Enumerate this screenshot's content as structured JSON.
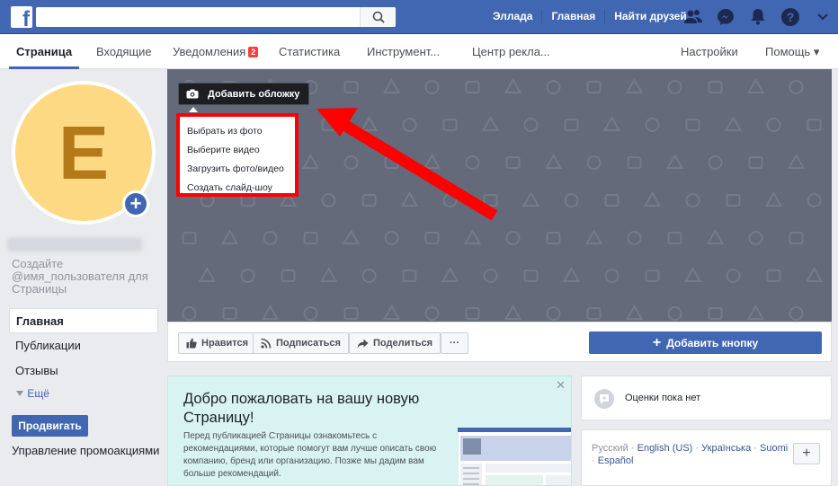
{
  "topbar": {
    "nav_links": [
      "Эллада",
      "Главная",
      "Найти друзей"
    ],
    "icons": [
      "friends-icon",
      "messenger-icon",
      "notifications-icon",
      "help-icon",
      "account-menu-icon"
    ]
  },
  "tabs": [
    {
      "label": "Страница"
    },
    {
      "label": "Входящие"
    },
    {
      "label": "Уведомления",
      "badge": "2"
    },
    {
      "label": "Статистика"
    },
    {
      "label": "Инструмент..."
    },
    {
      "label": "Центр рекла..."
    },
    {
      "label": "Настройки"
    },
    {
      "label": "Помощь ▾"
    }
  ],
  "profile": {
    "initial": "E",
    "create_username": "Создайте @имя_пользователя для Страницы"
  },
  "leftnav": {
    "items": [
      "Главная",
      "Публикации",
      "Отзывы"
    ],
    "more": "Ещё",
    "promote_button": "Продвигать",
    "manage_promotions": "Управление промоакциями"
  },
  "cover": {
    "add_cover_label": "Добавить обложку",
    "dropdown": [
      "Выбрать из фото",
      "Выберите видео",
      "Загрузить фото/видео",
      "Создать слайд-шоу"
    ]
  },
  "actions": {
    "like": "Нравится",
    "follow": "Подписаться",
    "share": "Поделиться",
    "more": "···",
    "add_button": "Добавить кнопку"
  },
  "welcome": {
    "title": "Добро пожаловать на вашу новую Страницу!",
    "text": "Перед публикацией Страницы ознакомьтесь с рекомендациями, которые помогут вам лучше описать свою компанию, бренд или организацию. Позже мы дадим вам больше рекомендаций."
  },
  "rating": {
    "text": "Оценки пока нет"
  },
  "languages": {
    "current": "Русский",
    "others": [
      "English (US)",
      "Українська",
      "Suomi",
      "Español"
    ],
    "add": "+"
  },
  "colors": {
    "brand": "#4267b2",
    "cover": "#646a7a",
    "highlight": "#ff0000",
    "avatar": "#fdd984"
  }
}
